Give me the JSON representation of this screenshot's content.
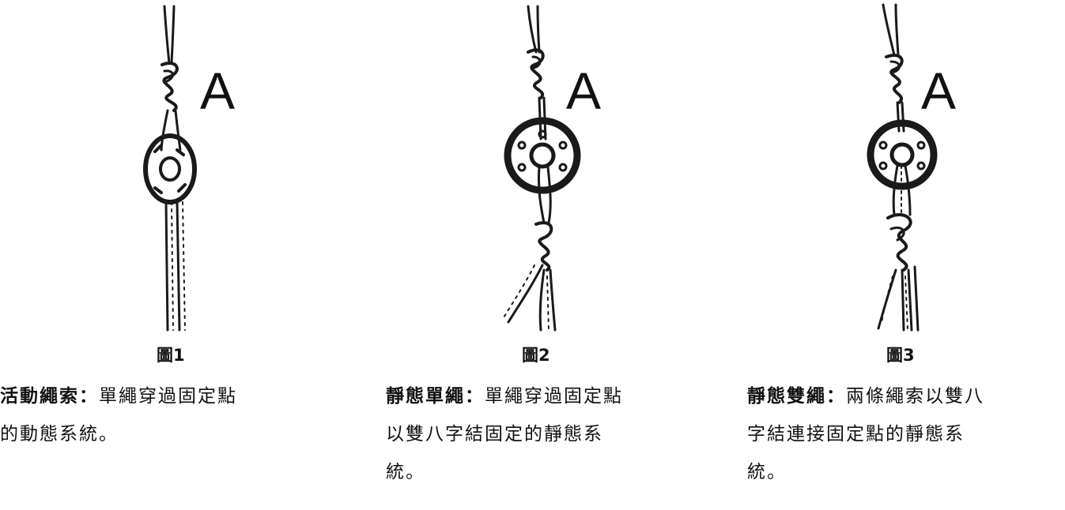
{
  "panels": [
    {
      "marker": "A",
      "figure_label": "圖1",
      "title": "活動繩索",
      "separator": "：",
      "lines": [
        "單繩穿過固定點",
        "的動態系統。"
      ]
    },
    {
      "marker": "A",
      "figure_label": "圖2",
      "title": "靜態單繩",
      "separator": "：",
      "lines": [
        "單繩穿過固定點",
        "以雙八字結固定的靜態系",
        "統。"
      ]
    },
    {
      "marker": "A",
      "figure_label": "圖3",
      "title": "靜態雙繩",
      "separator": "：",
      "lines": [
        "兩條繩索以雙八",
        "字結連接固定點的靜態系",
        "統。"
      ]
    }
  ]
}
